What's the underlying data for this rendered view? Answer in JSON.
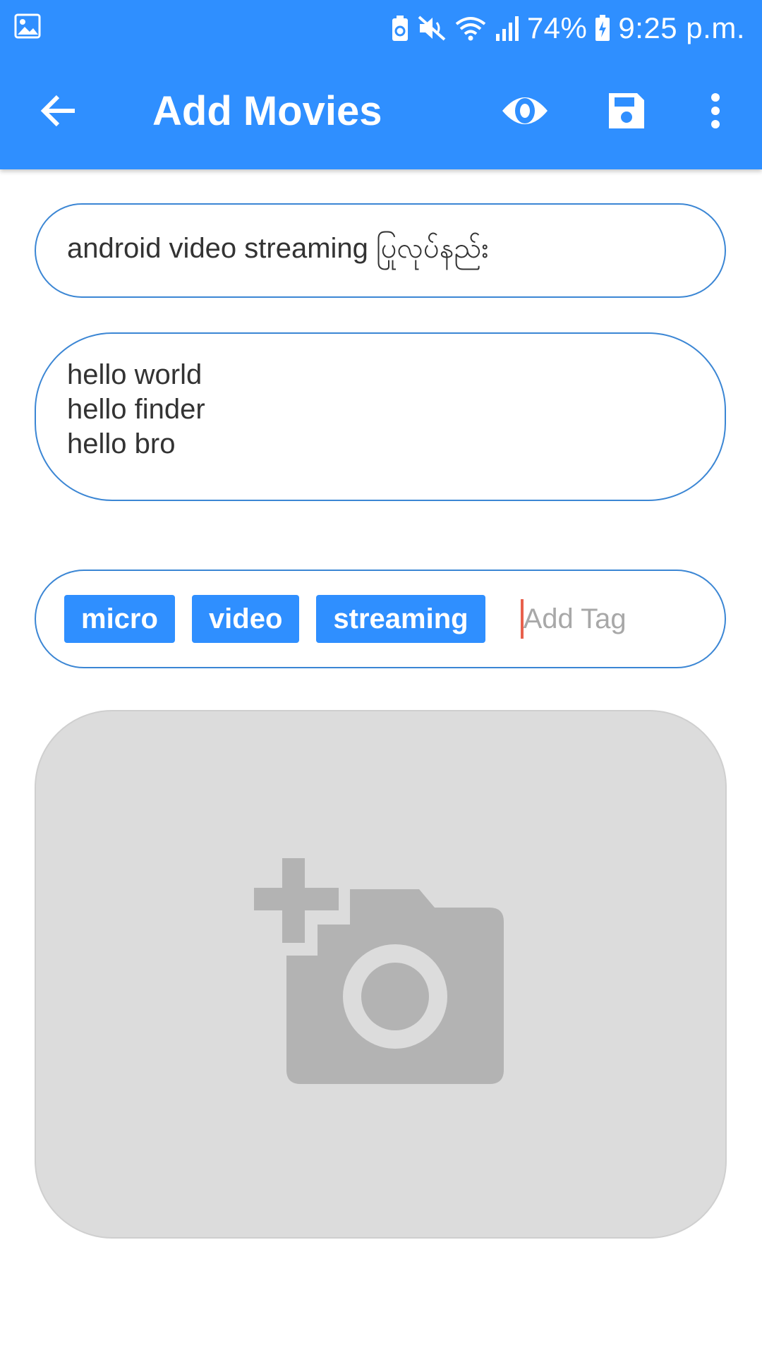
{
  "status_bar": {
    "gallery_icon": "gallery-notification-icon",
    "battery_percent": "74%",
    "time": "9:25 p.m."
  },
  "app_bar": {
    "title": "Add Movies",
    "back_icon": "arrow-left-icon",
    "actions": [
      "eye-icon",
      "save-icon",
      "more-vert-icon"
    ]
  },
  "form": {
    "title_value": "android video streaming ပြုလုပ်နည်း",
    "description_lines": [
      "hello world",
      "hello finder",
      "hello bro"
    ],
    "tags": [
      "micro",
      "video",
      "streaming"
    ],
    "tag_placeholder": "Add Tag",
    "image_picker_icon": "add-photo-camera-icon"
  },
  "colors": {
    "primary": "#2f8fff",
    "field_border": "#3b86d4",
    "picker_bg": "#dcdcdc",
    "icon_grey": "#b3b3b3",
    "caret": "#e8604c"
  }
}
